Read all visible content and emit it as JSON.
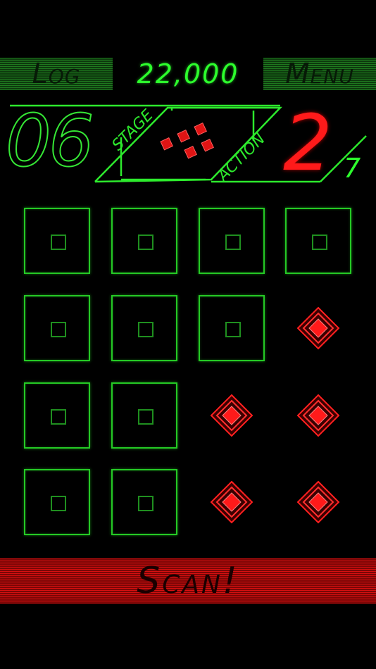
{
  "header": {
    "log_label": "Log",
    "menu_label": "Menu",
    "score": "22,000"
  },
  "hud": {
    "stage_label": "STAGE",
    "stage_number": "06",
    "action_label": "ACTION",
    "action_current": "2",
    "action_total": "7"
  },
  "grid": {
    "rows": [
      [
        "tile",
        "tile",
        "tile",
        "tile"
      ],
      [
        "tile",
        "tile",
        "tile",
        "mine"
      ],
      [
        "tile",
        "tile",
        "mine",
        "mine"
      ],
      [
        "tile",
        "tile",
        "mine",
        "mine"
      ]
    ]
  },
  "footer": {
    "scan_label": "Scan!"
  },
  "colors": {
    "background": "#000000",
    "accent_green": "#2dff2d",
    "accent_red": "#ff1a1a"
  }
}
